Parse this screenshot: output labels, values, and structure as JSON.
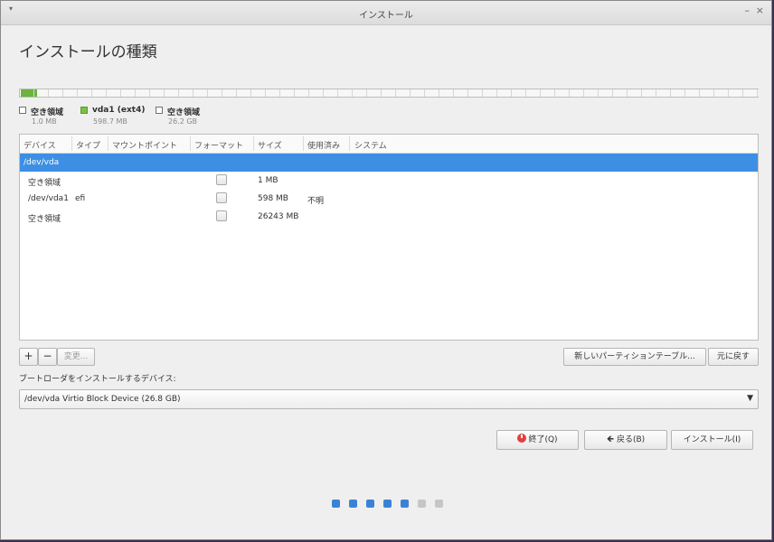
{
  "window": {
    "title": "インストール",
    "menu_glyph": "▾",
    "minimize_glyph": "–",
    "close_glyph": "×"
  },
  "page": {
    "heading": "インストールの種類"
  },
  "partition_bar": {
    "segments": [
      {
        "name": "空き領域",
        "fraction": 0.0004,
        "color": "#ffffff"
      },
      {
        "name": "vda1 (ext4)",
        "fraction": 0.0223,
        "color": "#6cb33f"
      },
      {
        "name": "空き領域",
        "fraction": 0.9773,
        "color": "#f7f7f7"
      }
    ]
  },
  "legend": [
    {
      "name": "空き領域",
      "size": "1.0 MB",
      "color": "#ffffff"
    },
    {
      "name": "vda1 (ext4)",
      "size": "598.7 MB",
      "color": "#7ac143"
    },
    {
      "name": "空き領域",
      "size": "26.2 GB",
      "color": "#ffffff"
    }
  ],
  "table": {
    "columns": [
      "デバイス",
      "タイプ",
      "マウントポイント",
      "フォーマット",
      "サイズ",
      "使用済み",
      "システム"
    ],
    "rows": [
      {
        "device": "/dev/vda",
        "type": "",
        "mount": "",
        "format": null,
        "size": "",
        "used": "",
        "system": "",
        "selected": true
      },
      {
        "device": "空き領域",
        "type": "",
        "mount": "",
        "format": false,
        "size": "1 MB",
        "used": "",
        "system": "",
        "selected": false
      },
      {
        "device": "/dev/vda1",
        "type": "efi",
        "mount": "",
        "format": false,
        "size": "598 MB",
        "used": "不明",
        "system": "",
        "selected": false
      },
      {
        "device": "空き領域",
        "type": "",
        "mount": "",
        "format": false,
        "size": "26243 MB",
        "used": "",
        "system": "",
        "selected": false
      }
    ]
  },
  "toolbar": {
    "add_label": "+",
    "remove_label": "−",
    "change_label": "変更...",
    "new_table_label": "新しいパーティションテーブル...",
    "revert_label": "元に戻す"
  },
  "bootloader": {
    "label": "ブートローダをインストールするデバイス:",
    "value": "/dev/vda   Virtio Block Device (26.8 GB)",
    "arrow_glyph": "▼"
  },
  "actions": {
    "quit_label": "終了(Q)",
    "back_label": "戻る(B)",
    "back_glyph": "🡸",
    "install_label": "インストール(I)"
  },
  "progress_dots": {
    "total": 7,
    "completed": 5,
    "active_color": "#3b82d6",
    "inactive_color": "#c6c6c6"
  }
}
